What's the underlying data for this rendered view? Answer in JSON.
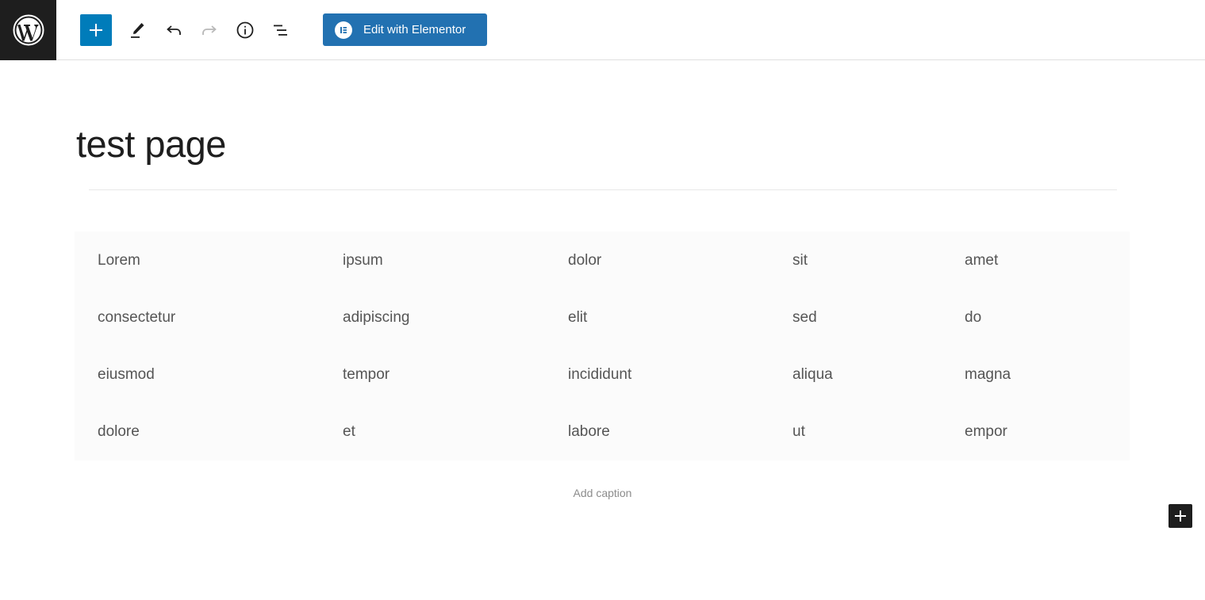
{
  "toolbar": {
    "elementor_label": "Edit with Elementor"
  },
  "editor": {
    "title": "test page",
    "caption_placeholder": "Add caption"
  },
  "table": {
    "rows": [
      [
        "Lorem",
        "ipsum",
        "dolor",
        "sit",
        "amet"
      ],
      [
        "consectetur",
        "adipiscing",
        "elit",
        "sed",
        "do"
      ],
      [
        "eiusmod",
        "tempor",
        "incididunt",
        "aliqua",
        "magna"
      ],
      [
        "dolore",
        "et",
        "labore",
        "ut",
        "empor"
      ]
    ]
  },
  "colors": {
    "accent": "#007cba",
    "elementor": "#2271b1",
    "dark": "#1e1e1e"
  },
  "icons": [
    "wordpress-logo-icon",
    "plus-icon",
    "pencil-icon",
    "undo-icon",
    "redo-icon",
    "info-icon",
    "list-view-icon",
    "elementor-icon"
  ]
}
